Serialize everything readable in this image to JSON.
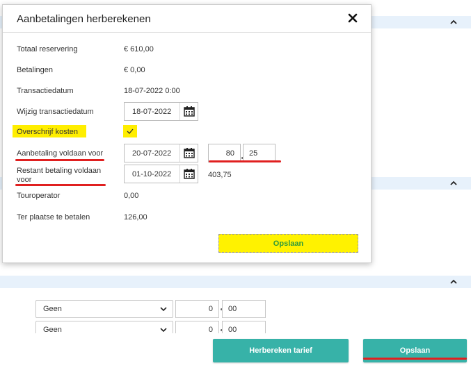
{
  "modal": {
    "title": "Aanbetalingen herberekenen",
    "rows": {
      "totaal_reservering": {
        "label": "Totaal reservering",
        "value": "€ 610,00"
      },
      "betalingen": {
        "label": "Betalingen",
        "value": "€ 0,00"
      },
      "transactiedatum": {
        "label": "Transactiedatum",
        "value": "18-07-2022 0:00"
      },
      "wijzig_transactiedatum": {
        "label": "Wijzig transactiedatum",
        "value": "18-07-2022"
      },
      "overschrijf_kosten": {
        "label": "Overschrijf kosten",
        "checked": true
      },
      "aanbetaling": {
        "label": "Aanbetaling voldaan voor",
        "date": "20-07-2022",
        "amount_whole": "80",
        "amount_cents": "25"
      },
      "restant": {
        "label": "Restant betaling voldaan voor",
        "date": "01-10-2022",
        "amount": "403,75"
      },
      "touroperator": {
        "label": "Touroperator",
        "value": "0,00"
      },
      "ter_plaatse": {
        "label": "Ter plaatse te betalen",
        "value": "126,00"
      }
    },
    "save_label": "Opslaan"
  },
  "background": {
    "rows": [
      {
        "select": "Geen",
        "whole": "0",
        "cents": "00"
      },
      {
        "select": "Geen",
        "whole": "0",
        "cents": "00"
      }
    ]
  },
  "footer": {
    "recalc_label": "Herbereken tarief",
    "save_label": "Opslaan"
  },
  "colors": {
    "accent_teal": "#37b2a8",
    "highlight_yellow": "#ffee00",
    "annotation_red": "#e02020",
    "section_bar": "#e7f1fb"
  }
}
